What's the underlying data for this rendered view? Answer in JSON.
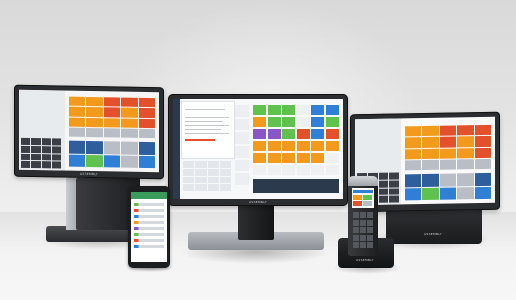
{
  "scene": {
    "background": "#e4e4e4",
    "devices": [
      {
        "name": "left-pos-terminal",
        "brand_text": "ASSEMBLY"
      },
      {
        "name": "center-pos-monitor",
        "brand_text": "ASSEMBLY"
      },
      {
        "name": "right-pos-terminal",
        "brand_text": "ASSEMBLY"
      },
      {
        "name": "smartphone"
      },
      {
        "name": "handheld-terminal",
        "brand_text": "ASSEMBLY"
      }
    ]
  },
  "colors": {
    "tile_orange": "#f39a1c",
    "tile_red": "#e4502b",
    "tile_green": "#5fc24c",
    "tile_blue": "#2f7fd6",
    "tile_purple": "#8a56c7",
    "tile_grey": "#b9bec6",
    "tile_navy": "#2f5e9e",
    "sidebar_dark": "#2b3a4c",
    "phone_header": "#3a9c5b"
  }
}
